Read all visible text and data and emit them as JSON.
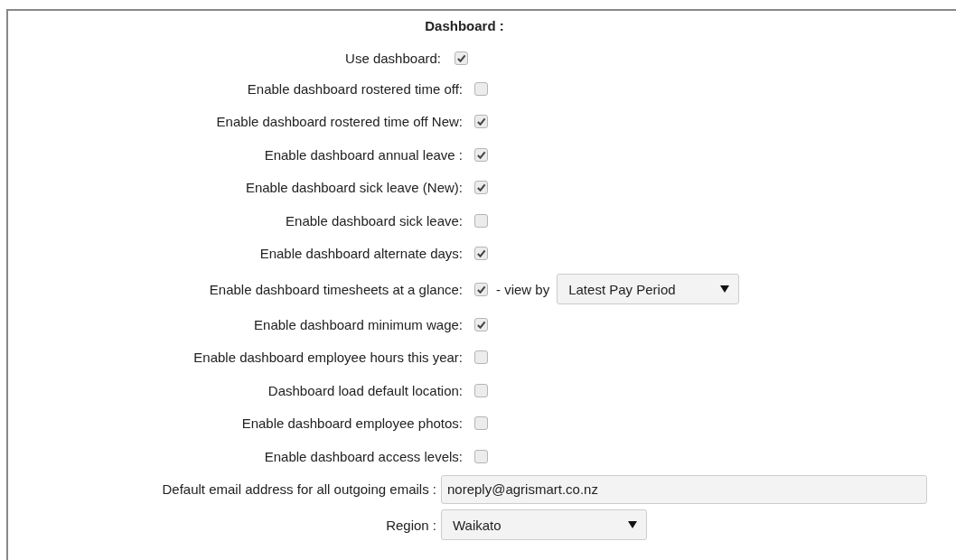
{
  "title": "Dashboard :",
  "rows": [
    {
      "kind": "main-checkbox",
      "label": "Use dashboard:",
      "checked": true
    },
    {
      "kind": "checkbox",
      "label": "Enable dashboard rostered time off:",
      "checked": false
    },
    {
      "kind": "checkbox",
      "label": "Enable dashboard rostered time off New:",
      "checked": true
    },
    {
      "kind": "checkbox",
      "label": "Enable dashboard annual leave :",
      "checked": true
    },
    {
      "kind": "checkbox",
      "label": "Enable dashboard sick leave (New):",
      "checked": true
    },
    {
      "kind": "checkbox",
      "label": "Enable dashboard sick leave:",
      "checked": false
    },
    {
      "kind": "checkbox",
      "label": "Enable dashboard alternate days:",
      "checked": true
    },
    {
      "kind": "checkbox",
      "label": "Enable dashboard timesheets at a glance:",
      "checked": true,
      "suffix": "- view by",
      "select": "Latest Pay Period"
    },
    {
      "kind": "checkbox",
      "label": "Enable dashboard minimum wage:",
      "checked": true
    },
    {
      "kind": "checkbox",
      "label": "Enable dashboard employee hours this year:",
      "checked": false
    },
    {
      "kind": "checkbox",
      "label": "Dashboard load default location:",
      "checked": false
    },
    {
      "kind": "checkbox",
      "label": "Enable dashboard employee photos:",
      "checked": false
    },
    {
      "kind": "checkbox",
      "label": "Enable dashboard access levels:",
      "checked": false
    },
    {
      "kind": "text",
      "label": "Default email address for all outgoing emails :",
      "value": "noreply@agrismart.co.nz"
    },
    {
      "kind": "select",
      "label": "Region :",
      "value": "Waikato"
    }
  ]
}
